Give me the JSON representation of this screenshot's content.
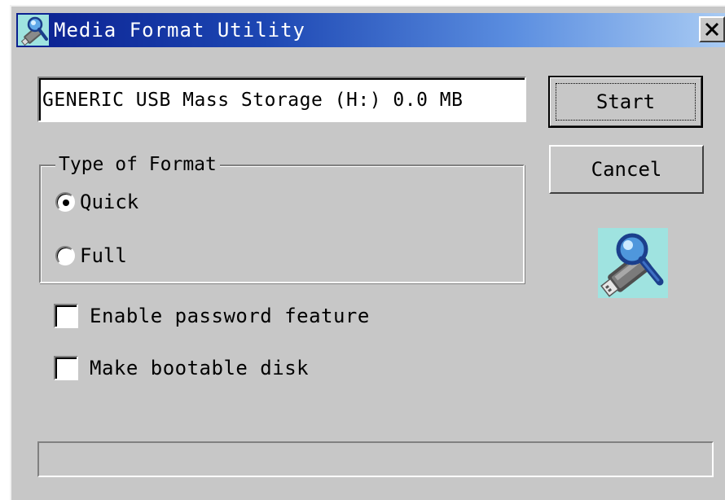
{
  "window": {
    "title": "Media Format Utility",
    "title_icon": "usb-magnifier-icon",
    "close_icon": "close-icon"
  },
  "device": {
    "value": "GENERIC USB Mass Storage (H:)  0.0 MB"
  },
  "buttons": {
    "start": "Start",
    "cancel": "Cancel"
  },
  "format_type": {
    "legend": "Type of Format",
    "options": [
      {
        "label": "Quick",
        "selected": true
      },
      {
        "label": "Full",
        "selected": false
      }
    ]
  },
  "options": {
    "password": {
      "label": "Enable password feature",
      "checked": false
    },
    "bootable": {
      "label": "Make bootable disk",
      "checked": false
    }
  },
  "picture_icon": "usb-drive-magnifier-icon",
  "progress": {
    "fraction": 0
  },
  "colors": {
    "title_gradient_start": "#0a1f8f",
    "title_gradient_end": "#a9cbf3",
    "window_bg": "#c7c7c7",
    "picture_bg": "#9fe3e0"
  }
}
